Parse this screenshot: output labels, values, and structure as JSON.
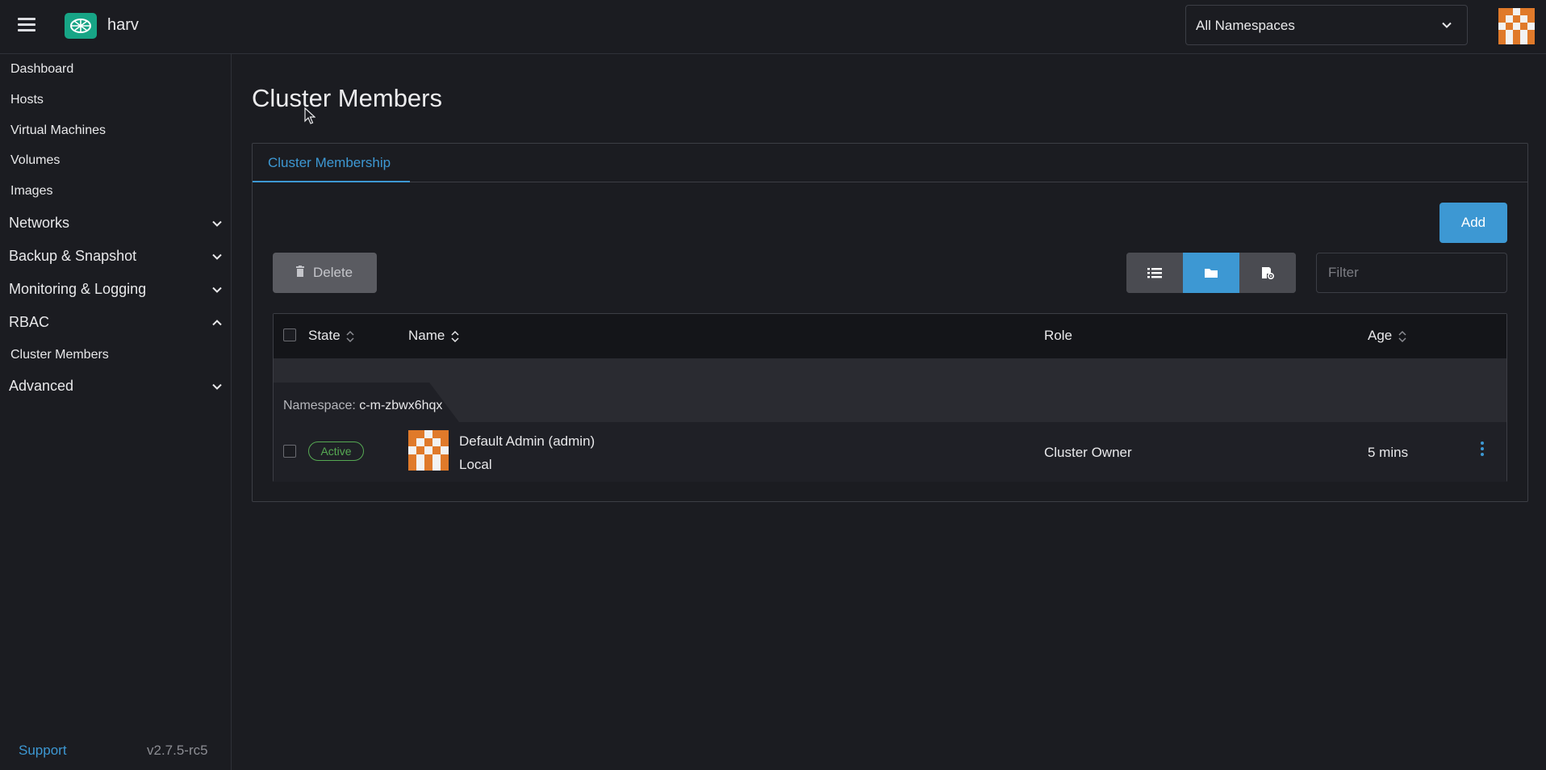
{
  "header": {
    "cluster_name": "harv",
    "namespace_select": {
      "value": "All Namespaces"
    },
    "accent": "#3d98d3",
    "logo_color": "#17a586"
  },
  "sidebar": {
    "items": [
      {
        "label": "Dashboard"
      },
      {
        "label": "Hosts"
      },
      {
        "label": "Virtual Machines"
      },
      {
        "label": "Volumes"
      },
      {
        "label": "Images"
      }
    ],
    "groups": [
      {
        "label": "Networks",
        "expanded": false
      },
      {
        "label": "Backup & Snapshot",
        "expanded": false
      },
      {
        "label": "Monitoring & Logging",
        "expanded": false
      },
      {
        "label": "RBAC",
        "expanded": true,
        "children": [
          {
            "label": "Cluster Members"
          }
        ]
      },
      {
        "label": "Advanced",
        "expanded": false
      }
    ],
    "support_label": "Support",
    "version": "v2.7.5-rc5"
  },
  "main": {
    "title": "Cluster Members",
    "tabs": [
      {
        "label": "Cluster Membership",
        "active": true
      }
    ],
    "add_label": "Add",
    "delete_label": "Delete",
    "view_modes": [
      "flat-list-icon",
      "group-by-namespace-icon",
      "group-by-project-icon"
    ],
    "active_view": "group-by-namespace-icon",
    "filter_placeholder": "Filter",
    "table": {
      "columns": [
        "State",
        "Name",
        "Role",
        "Age"
      ],
      "group_prefix": "Namespace:",
      "group_value": "c-m-zbwx6hqx",
      "rows": [
        {
          "state": "Active",
          "state_color": "#56a953",
          "name": "Default Admin (admin)",
          "provider": "Local",
          "role": "Cluster Owner",
          "age": "5 mins"
        }
      ]
    }
  }
}
